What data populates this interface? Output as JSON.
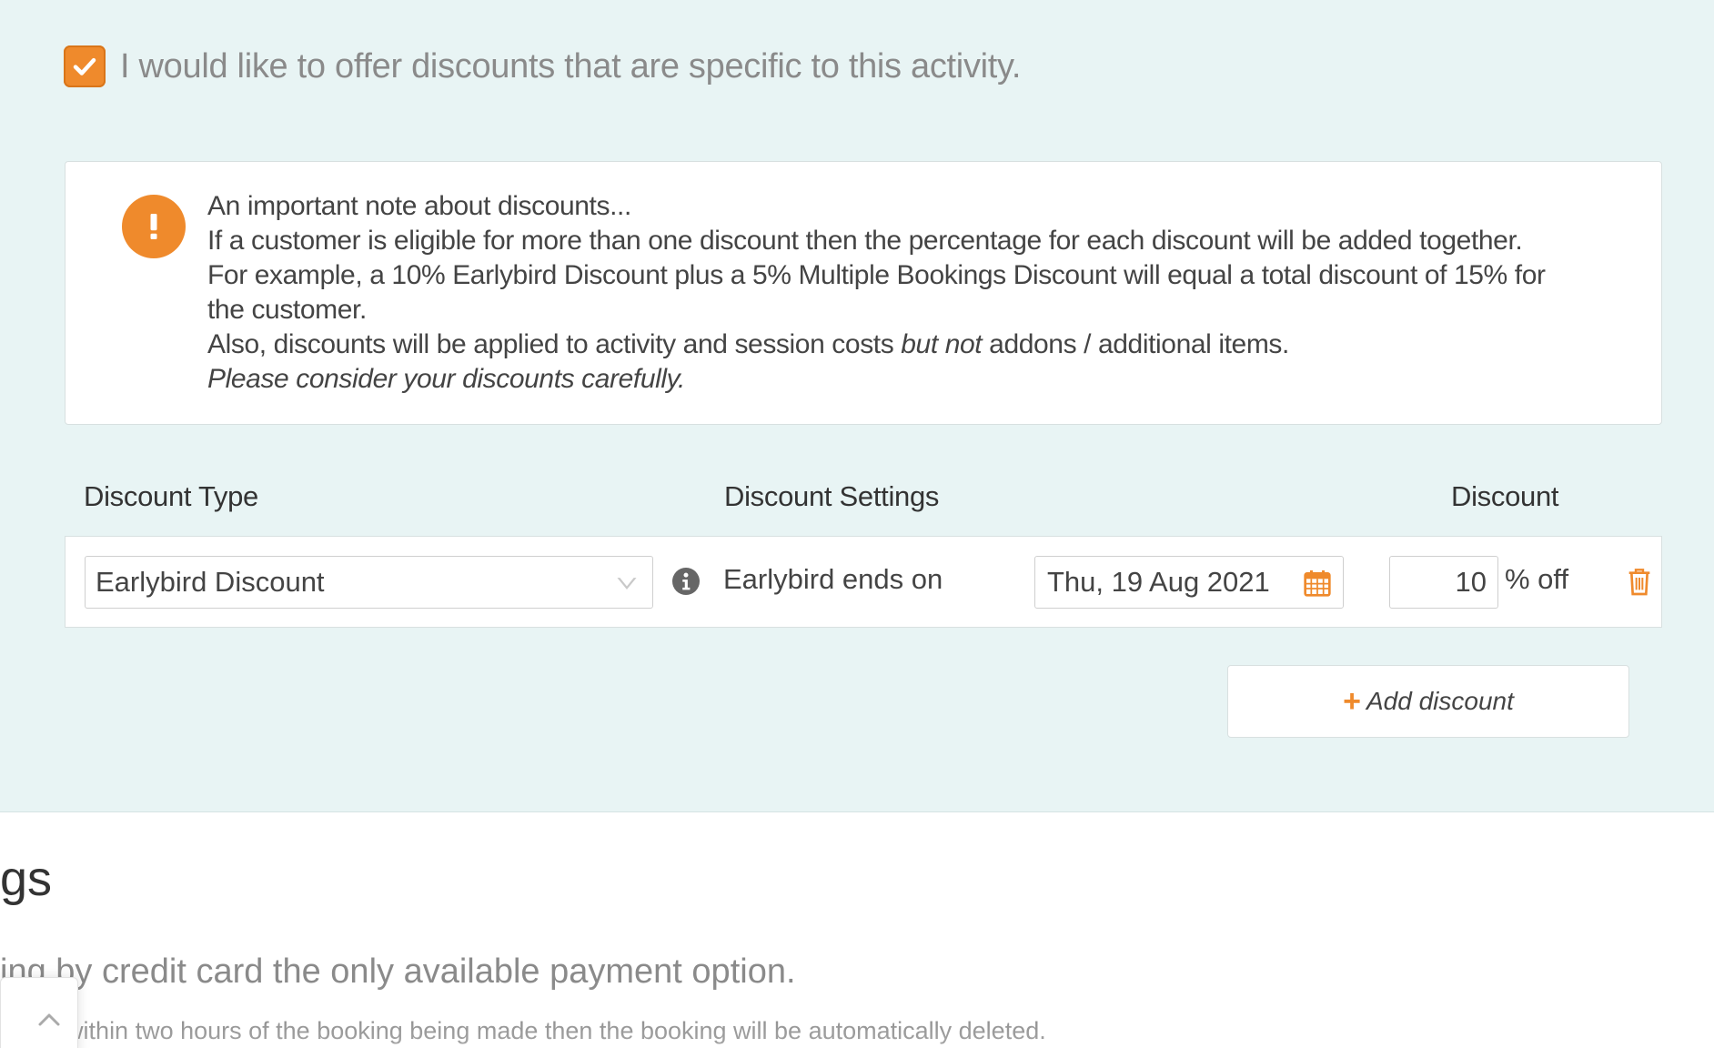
{
  "offer": {
    "checked": true,
    "label": "I would like to offer discounts that are specific to this activity."
  },
  "note": {
    "title": "An important note about discounts...",
    "line1": "If a customer is eligible for more than one discount then the percentage for each discount will be added together.",
    "line2": "For example, a 10% Earlybird Discount plus a 5% Multiple Bookings Discount will equal a total discount of 15% for",
    "line3": "the customer.",
    "line4_pre": "Also, discounts will be applied to activity and session costs ",
    "line4_em": "but not",
    "line4_post": " addons / additional items.",
    "line5": "Please consider your discounts carefully.",
    "icon": "exclamation-icon"
  },
  "table": {
    "headers": {
      "type": "Discount Type",
      "settings": "Discount Settings",
      "discount": "Discount"
    },
    "rows": [
      {
        "type_value": "Earlybird Discount",
        "settings_label": "Earlybird ends on",
        "date_value": "Thu, 19 Aug 2021",
        "percent_value": "10",
        "percent_suffix": "% off"
      }
    ]
  },
  "add_button": {
    "label": "Add discount"
  },
  "below": {
    "heading": "gs",
    "line1": "ing by credit card the only available payment option.",
    "line2": "eived within two hours of the booking being made then the booking will be automatically deleted."
  },
  "colors": {
    "accent": "#ef8a2c",
    "section_bg": "#e8f4f4"
  }
}
